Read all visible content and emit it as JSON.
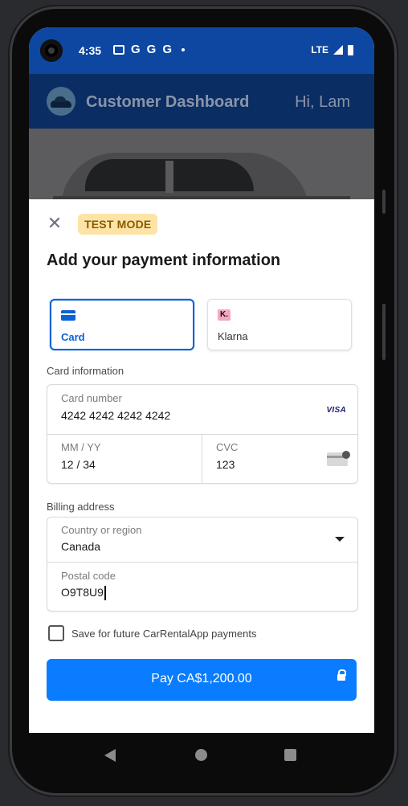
{
  "status_bar": {
    "time": "4:35",
    "notifications": [
      "G",
      "G",
      "G"
    ],
    "network": "LTE"
  },
  "app_bar": {
    "title": "Customer Dashboard",
    "greeting": "Hi, Lam"
  },
  "sheet": {
    "badge": "TEST MODE",
    "title": "Add your payment information",
    "payment_methods": [
      {
        "label": "Card",
        "icon": "credit-card-icon",
        "selected": true
      },
      {
        "label": "Klarna",
        "icon_text": "K.",
        "selected": false
      }
    ],
    "card_section_label": "Card information",
    "card_number": {
      "label": "Card number",
      "value": "4242 4242 4242 4242",
      "brand": "VISA"
    },
    "expiry": {
      "label": "MM / YY",
      "value": "12 / 34"
    },
    "cvc": {
      "label": "CVC",
      "value": "123"
    },
    "billing_section_label": "Billing address",
    "country": {
      "label": "Country or region",
      "value": "Canada"
    },
    "postal": {
      "label": "Postal code",
      "value": "O9T8U9"
    },
    "save_label": "Save for future CarRentalApp payments",
    "save_checked": false,
    "pay_label": "Pay CA$1,200.00"
  },
  "colors": {
    "status_bar": "#0d47a1",
    "app_bar": "#0a2d63",
    "accent": "#0a62d6",
    "pay_button": "#0a7cff",
    "badge_bg": "#fde4a6"
  }
}
